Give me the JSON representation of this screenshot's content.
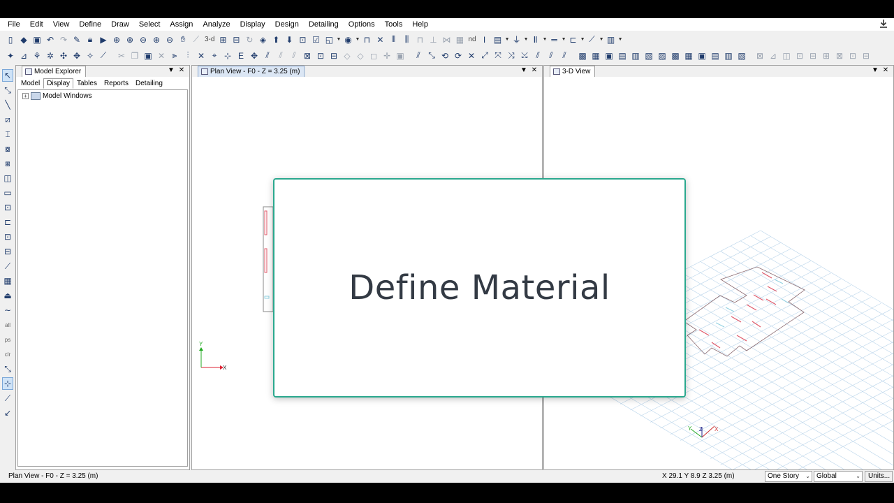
{
  "menu": [
    "File",
    "Edit",
    "View",
    "Define",
    "Draw",
    "Select",
    "Assign",
    "Analyze",
    "Display",
    "Design",
    "Detailing",
    "Options",
    "Tools",
    "Help"
  ],
  "toolbar": {
    "label_3d": "3-d",
    "label_nd": "nd"
  },
  "explorer": {
    "title": "Model Explorer",
    "tabs": [
      "Model",
      "Display",
      "Tables",
      "Reports",
      "Detailing"
    ],
    "active_tab": "Display",
    "tree_root": "Model Windows"
  },
  "plan_view": {
    "title": "Plan View - F0 - Z = 3.25 (m)",
    "axis_x": "X",
    "axis_y": "Y"
  },
  "view3d": {
    "title": "3-D View",
    "axis_x": "X",
    "axis_y": "Y",
    "axis_z": "Z"
  },
  "overlay": {
    "title": "Define Material"
  },
  "status": {
    "left_text": "Plan View - F0 - Z = 3.25 (m)",
    "coords": "X 29.1  Y 8.9  Z 3.25 (m)",
    "story_select": "One Story",
    "coord_select": "Global",
    "units_button": "Units..."
  },
  "colors": {
    "overlay_border": "#2aa88e",
    "grid_line": "#b9d4ea",
    "frame_red": "#e05a6a"
  }
}
